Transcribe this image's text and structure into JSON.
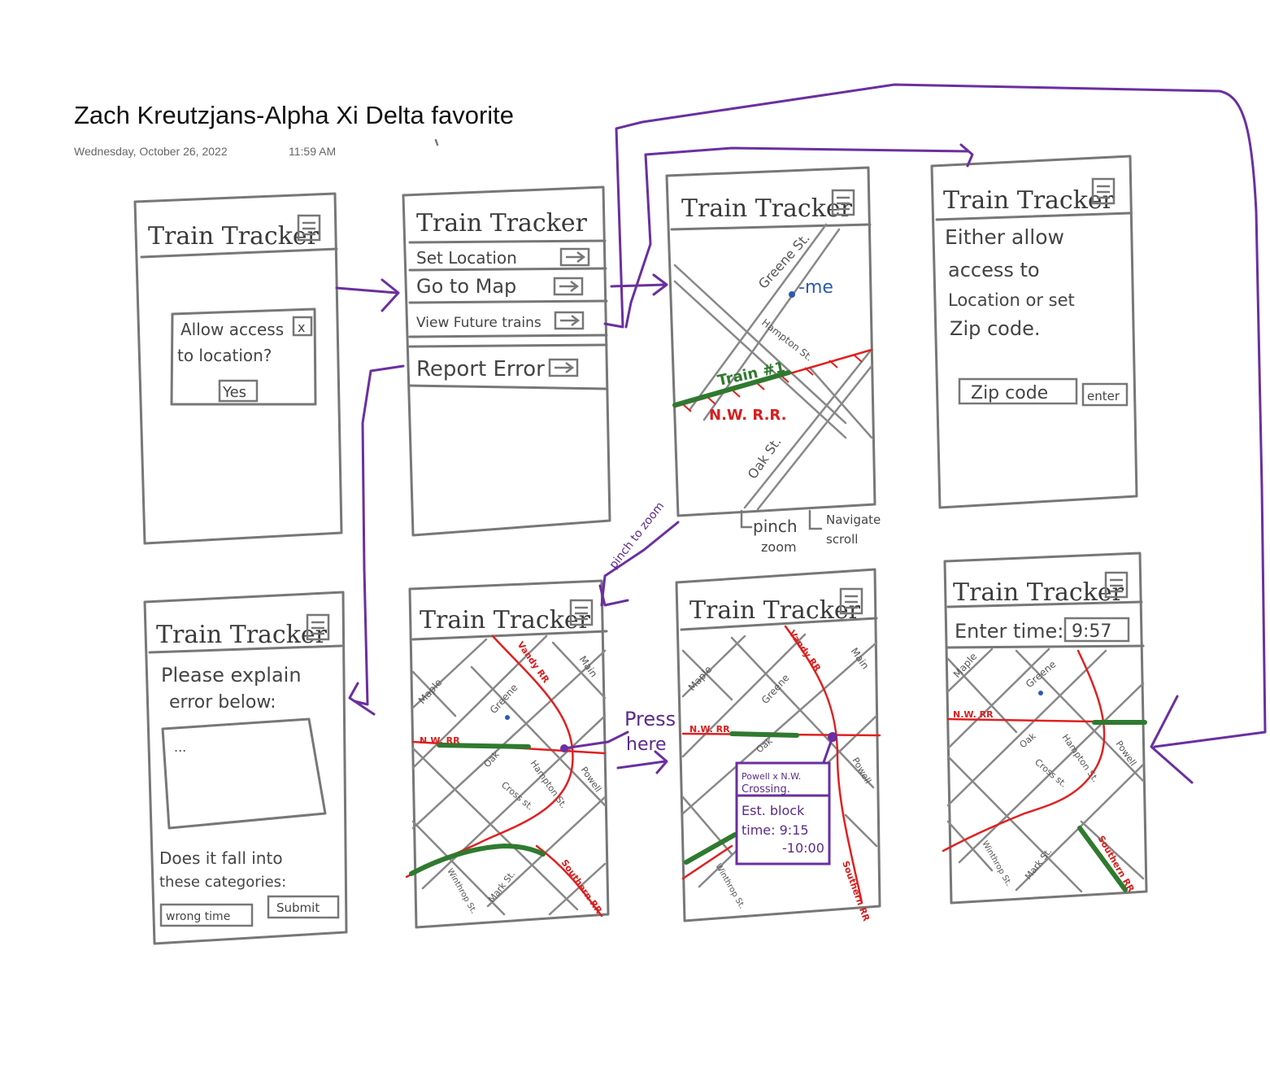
{
  "page": {
    "title": "Zach Kreutzjans-Alpha Xi Delta favorite",
    "date": "Wednesday, October 26, 2022",
    "time": "11:59 AM"
  },
  "app_title": "Train Tracker",
  "screens": {
    "permission": {
      "dialog_line1": "Allow access",
      "dialog_line2": "to location?",
      "close": "x",
      "yes": "Yes"
    },
    "menu": {
      "items": [
        "Set Location",
        "Go to Map",
        "View Future trains",
        "Report Error"
      ]
    },
    "map": {
      "streets": [
        "Greene St.",
        "Hampton St.",
        "Oak St."
      ],
      "me": "-me",
      "train": "Train #1",
      "railroad": "N.W. R.R.",
      "gesture_pinch": "pinch",
      "gesture_zoom": "zoom",
      "gesture_navigate": "Navigate",
      "gesture_scroll": "scroll"
    },
    "location": {
      "text_lines": [
        "Either allow",
        "access to",
        "Location or set",
        "Zip code."
      ],
      "zip_placeholder": "Zip code",
      "enter": "enter"
    },
    "report": {
      "prompt_line1": "Please explain",
      "prompt_line2": "error below:",
      "textarea_placeholder": "...",
      "question_line1": "Does it fall into",
      "question_line2": "these categories:",
      "category": "wrong time",
      "submit": "Submit"
    },
    "zoomed_map": {
      "streets": [
        "Maple",
        "Greene",
        "Main",
        "Oak",
        "Hampton St.",
        "Cross st.",
        "Powell",
        "Winthrop St.",
        "Mark St."
      ],
      "railroads": [
        "N.W. RR",
        "Vandy RR",
        "Southern RR"
      ]
    },
    "crossing": {
      "popup_title_line1": "Powell x N.W.",
      "popup_title_line2": "Crossing.",
      "popup_line1": "Est. block",
      "popup_line2": "time: 9:15",
      "popup_line3": "-10:00"
    },
    "future": {
      "enter_time_label": "Enter time:",
      "time_value": "9:57"
    }
  },
  "annotations": {
    "pinch_to_zoom": "pinch to zoom",
    "press_line1": "Press",
    "press_line2": "here"
  },
  "colors": {
    "sketch_gray": "#777777",
    "flow_purple": "#6a2fa0",
    "railroad_red": "#e02020",
    "train_green": "#2f7a2f",
    "me_blue": "#2b59b5"
  }
}
